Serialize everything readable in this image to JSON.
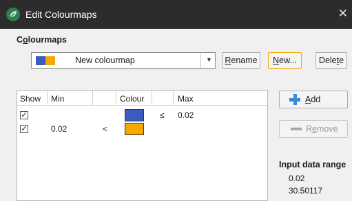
{
  "window": {
    "title": "Edit Colourmaps",
    "close_glyph": "✕"
  },
  "colourmaps": {
    "section_title_pre": "C",
    "section_title_u": "o",
    "section_title_post": "lourmaps",
    "selected": "New colourmap",
    "swatch_colors": [
      "#3b5bbf",
      "#f5a800"
    ]
  },
  "buttons": {
    "rename": {
      "u": "R",
      "rest": "ename"
    },
    "new": {
      "u": "N",
      "rest": "ew..."
    },
    "delete": {
      "pre": "Dele",
      "u": "t",
      "post": "e"
    },
    "add": {
      "u": "A",
      "rest": "dd"
    },
    "remove": {
      "pre": "R",
      "u": "e",
      "post": "move"
    }
  },
  "table": {
    "columns": [
      "Show",
      "Min",
      "Colour",
      "Max"
    ],
    "rows": [
      {
        "show": true,
        "min": "",
        "min_op": "",
        "colour": "#3b5bbf",
        "max_op": "≤",
        "max": "0.02"
      },
      {
        "show": true,
        "min": "0.02",
        "min_op": "<",
        "colour": "#f5a800",
        "max_op": "",
        "max": ""
      }
    ]
  },
  "input_range": {
    "title": "Input data range",
    "min": "0.02",
    "max": "30.50117"
  },
  "icons": {
    "app": "leaf-app-icon",
    "add": "plus-icon",
    "remove": "minus-icon",
    "dropdown": "chevron-down-icon",
    "check": "check-icon"
  }
}
